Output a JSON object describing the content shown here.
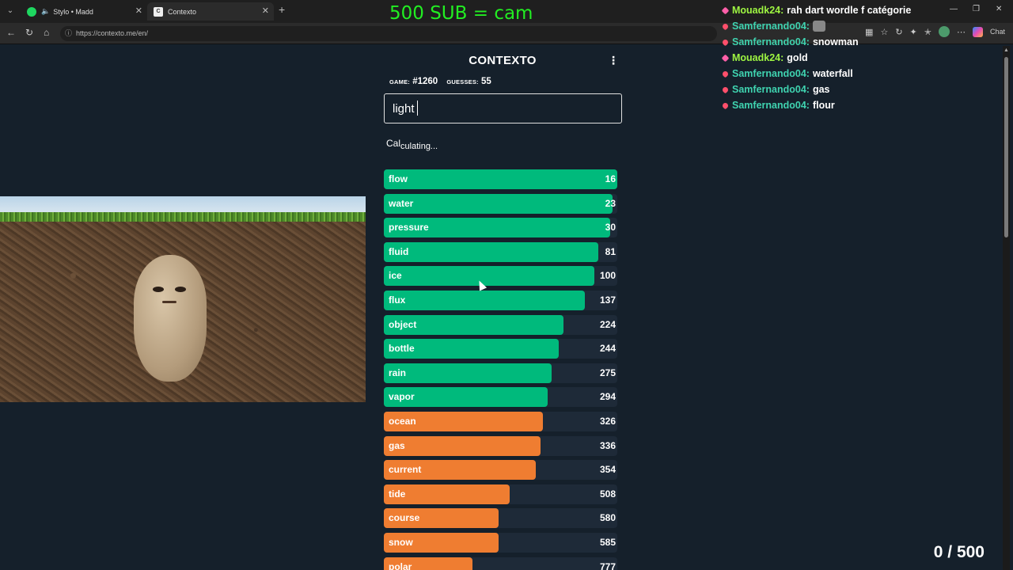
{
  "browser": {
    "tabs": [
      {
        "title": "Stylo • Madd"
      },
      {
        "title": "Contexto",
        "favicon": "C"
      }
    ],
    "url": "https://contexto.me/en/",
    "chat_button": "Chat"
  },
  "overlay": {
    "sub_goal": "500 SUB = cam",
    "counter": "0 / 500",
    "chat": [
      {
        "user": "Mouadk24:",
        "message": "rah dart wordle f catégorie",
        "color": "#9ef542",
        "badge": "sword"
      },
      {
        "user": "Samfernando04:",
        "message": "",
        "color": "#3fd3b0",
        "badge": "heart",
        "emote": true
      },
      {
        "user": "Samfernando04:",
        "message": "snowman",
        "color": "#3fd3b0",
        "badge": "heart"
      },
      {
        "user": "Mouadk24:",
        "message": "gold",
        "color": "#9ef542",
        "badge": "sword"
      },
      {
        "user": "Samfernando04:",
        "message": "waterfall",
        "color": "#3fd3b0",
        "badge": "heart"
      },
      {
        "user": "Samfernando04:",
        "message": "gas",
        "color": "#3fd3b0",
        "badge": "heart"
      },
      {
        "user": "Samfernando04:",
        "message": "flour",
        "color": "#3fd3b0",
        "badge": "heart"
      }
    ]
  },
  "app": {
    "title": "CONTEXTO",
    "game_label": "GAME:",
    "game_number": "#1260",
    "guesses_label": "GUESSES:",
    "guesses_count": "55",
    "input_value": "light",
    "status_part1": "Cal",
    "status_part2": "culating...",
    "colors": {
      "green": "#00ba7c",
      "orange": "#ef7d31",
      "track": "#1e2a38"
    },
    "guesses": [
      {
        "word": "flow",
        "rank": "16",
        "fill": 1.0,
        "color": "green"
      },
      {
        "word": "water",
        "rank": "23",
        "fill": 0.98,
        "color": "green"
      },
      {
        "word": "pressure",
        "rank": "30",
        "fill": 0.97,
        "color": "green"
      },
      {
        "word": "fluid",
        "rank": "81",
        "fill": 0.92,
        "color": "green"
      },
      {
        "word": "ice",
        "rank": "100",
        "fill": 0.9,
        "color": "green"
      },
      {
        "word": "flux",
        "rank": "137",
        "fill": 0.86,
        "color": "green"
      },
      {
        "word": "object",
        "rank": "224",
        "fill": 0.77,
        "color": "green"
      },
      {
        "word": "bottle",
        "rank": "244",
        "fill": 0.75,
        "color": "green"
      },
      {
        "word": "rain",
        "rank": "275",
        "fill": 0.72,
        "color": "green"
      },
      {
        "word": "vapor",
        "rank": "294",
        "fill": 0.7,
        "color": "green"
      },
      {
        "word": "ocean",
        "rank": "326",
        "fill": 0.68,
        "color": "orange"
      },
      {
        "word": "gas",
        "rank": "336",
        "fill": 0.67,
        "color": "orange"
      },
      {
        "word": "current",
        "rank": "354",
        "fill": 0.65,
        "color": "orange"
      },
      {
        "word": "tide",
        "rank": "508",
        "fill": 0.54,
        "color": "orange"
      },
      {
        "word": "course",
        "rank": "580",
        "fill": 0.49,
        "color": "orange"
      },
      {
        "word": "snow",
        "rank": "585",
        "fill": 0.49,
        "color": "orange"
      },
      {
        "word": "polar",
        "rank": "777",
        "fill": 0.38,
        "color": "orange"
      }
    ]
  }
}
